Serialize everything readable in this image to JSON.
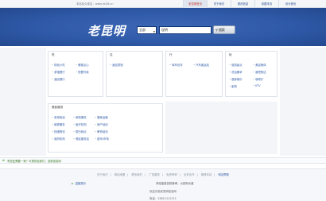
{
  "topbar": {
    "site_text": "本站永久域名：www.lm28.cn",
    "nav": [
      {
        "label": "老昆明首页"
      },
      {
        "label": "关于我们"
      },
      {
        "label": "更改信息"
      },
      {
        "label": "收藏本页"
      },
      {
        "label": "设为首页"
      }
    ]
  },
  "banner": {
    "logo": "老昆明",
    "category_select": "全部",
    "search_value": "昆明",
    "search_button": "搜索"
  },
  "panels": {
    "eat": {
      "title": "吃",
      "links": [
        "特色小吃",
        "蛋糕点心",
        "茶馆餐厅",
        "快餐外卖",
        "酒店餐厅"
      ]
    },
    "live": {
      "title": "住",
      "links": [
        "酒店宾馆"
      ]
    },
    "travel": {
      "title": "行",
      "links": [
        "驾车包车",
        "汽车客运站"
      ]
    },
    "play": {
      "title": "玩",
      "links": [
        "旅游景点",
        "美容美体",
        "洗浴桑拿",
        "酒吧夜店",
        "健身娱乐",
        "咖啡厅",
        "影院",
        "KTV"
      ]
    },
    "service": {
      "title": "便民服务",
      "links": [
        "常用电话",
        "家政服务",
        "搬家运输",
        "维修服务",
        "医疗机构",
        "房产经纪",
        "快递物流",
        "银行网点",
        "教育培训",
        "政府机构",
        "便民服务站",
        "超市/市场"
      ]
    }
  },
  "infobar": {
    "message": "有您还需要一家？可提供给我们，创新信息网"
  },
  "footer": {
    "links": [
      "关于我们",
      "网站地图",
      "联系我们",
      "广告服务",
      "免责声明",
      "业务合作",
      "推荐本站",
      "网站帮助"
    ],
    "notice": "温馨提示",
    "disclaimer": "本站信息仅供参考，以实际为准",
    "copyright": "欢迎光临老昆明信息网",
    "phone": "电话：13811111111"
  }
}
